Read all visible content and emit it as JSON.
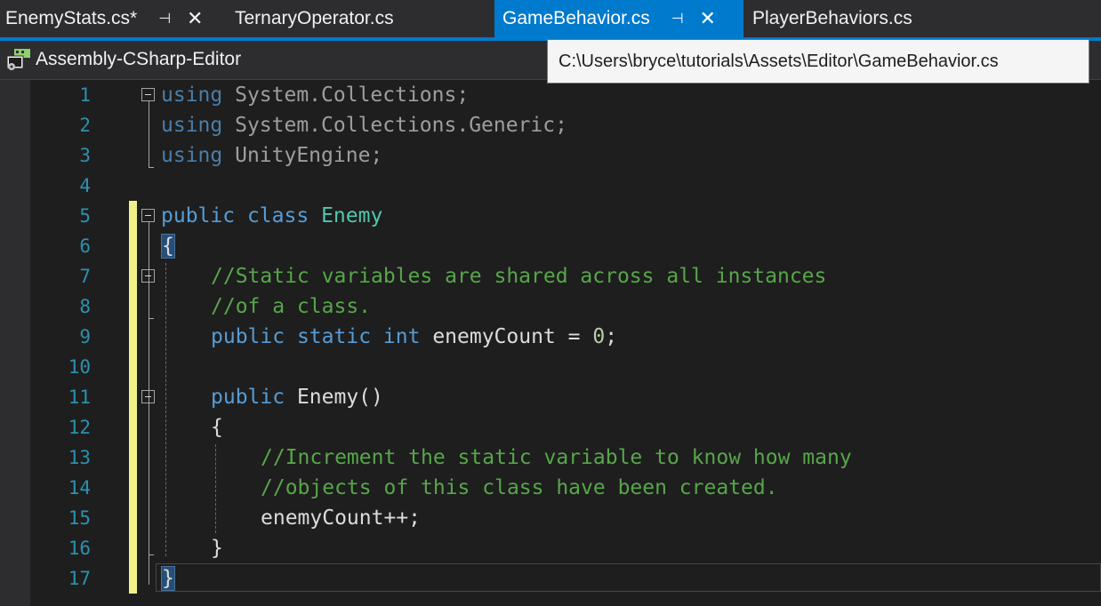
{
  "tabs": [
    {
      "label": "EnemyStats.cs*",
      "pinned": true,
      "closable": true,
      "active": false
    },
    {
      "label": "TernaryOperator.cs",
      "pinned": false,
      "closable": false,
      "active": false
    },
    {
      "label": "GameBehavior.cs",
      "pinned": true,
      "closable": true,
      "active": true
    },
    {
      "label": "PlayerBehaviors.cs",
      "pinned": false,
      "closable": false,
      "active": false
    }
  ],
  "tab_icons": {
    "pin": "⊣",
    "close": "✕"
  },
  "navbar": {
    "project": "Assembly-CSharp-Editor"
  },
  "tooltip": {
    "text": "C:\\Users\\bryce\\tutorials\\Assets\\Editor\\GameBehavior.cs"
  },
  "line_numbers": [
    "1",
    "2",
    "3",
    "4",
    "5",
    "6",
    "7",
    "8",
    "9",
    "10",
    "11",
    "12",
    "13",
    "14",
    "15",
    "16",
    "17"
  ],
  "code": {
    "l1": {
      "kw": "using",
      "rest": " System.Collections;"
    },
    "l2": {
      "kw": "using",
      "rest": " System.Collections.Generic;"
    },
    "l3": {
      "kw": "using",
      "rest": " UnityEngine;"
    },
    "l5": {
      "kw1": "public",
      "kw2": "class",
      "name": "Enemy"
    },
    "l6": {
      "brace": "{"
    },
    "l7": {
      "comment": "//Static variables are shared across all instances"
    },
    "l8": {
      "comment": "//of a class."
    },
    "l9": {
      "kw1": "public",
      "kw2": "static",
      "kw3": "int",
      "ident": "enemyCount",
      "op": " = ",
      "num": "0",
      "end": ";"
    },
    "l11": {
      "kw": "public",
      "rest": " Enemy()"
    },
    "l12": {
      "brace": "{"
    },
    "l13": {
      "comment": "//Increment the static variable to know how many"
    },
    "l14": {
      "comment": "//objects of this class have been created."
    },
    "l15": {
      "stmt": "enemyCount++;"
    },
    "l16": {
      "brace": "}"
    },
    "l17": {
      "brace": "}"
    }
  },
  "colors": {
    "keyword": "#569cd6",
    "type": "#4ec9b0",
    "comment": "#57a64a",
    "number": "#b5cea8",
    "line_number": "#2b91af",
    "accent": "#007acc",
    "change_bar": "#eff08a"
  }
}
